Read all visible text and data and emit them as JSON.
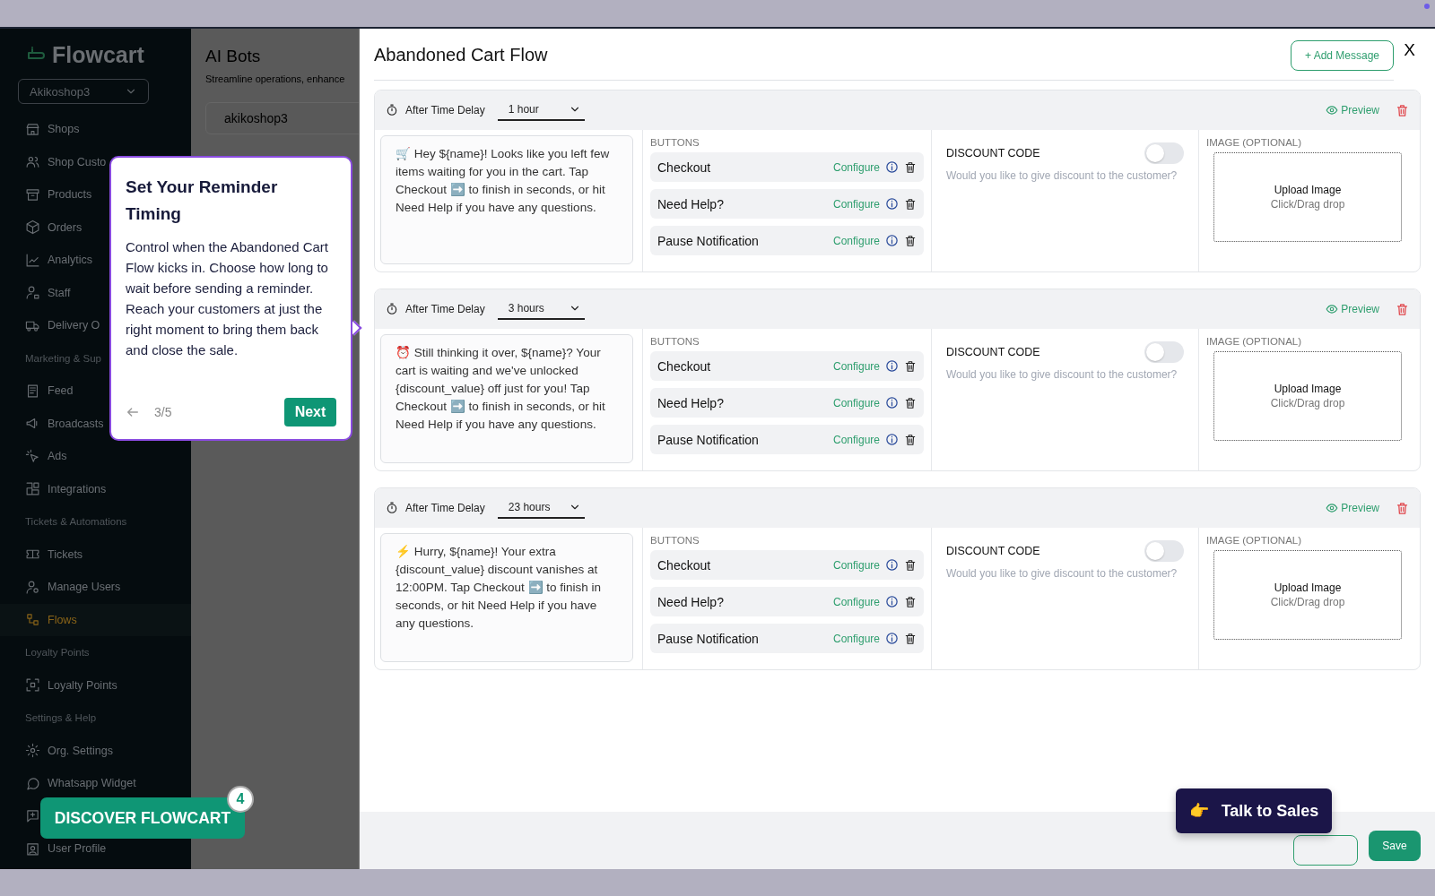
{
  "sidebar": {
    "logo": "Flowcart",
    "shop_select": "Akikoshop3",
    "items": [
      {
        "kind": "item",
        "label": "Shops",
        "selected": false
      },
      {
        "kind": "item",
        "label": "Shop Custo",
        "selected": false
      },
      {
        "kind": "item",
        "label": "Products",
        "selected": false
      },
      {
        "kind": "item",
        "label": "Orders",
        "selected": false
      },
      {
        "kind": "item",
        "label": "Analytics",
        "selected": false
      },
      {
        "kind": "item",
        "label": "Staff",
        "selected": false
      },
      {
        "kind": "item",
        "label": "Delivery O",
        "selected": false
      },
      {
        "kind": "section",
        "label": "Marketing & Sup"
      },
      {
        "kind": "item",
        "label": "Feed",
        "selected": false
      },
      {
        "kind": "item",
        "label": "Broadcasts",
        "selected": false
      },
      {
        "kind": "item",
        "label": "Ads",
        "selected": false
      },
      {
        "kind": "item",
        "label": "Integrations",
        "selected": false
      },
      {
        "kind": "section",
        "label": "Tickets & Automations"
      },
      {
        "kind": "item",
        "label": "Tickets",
        "selected": false
      },
      {
        "kind": "item",
        "label": "Manage Users",
        "selected": false
      },
      {
        "kind": "item",
        "label": "Flows",
        "selected": true
      },
      {
        "kind": "section",
        "label": "Loyalty Points"
      },
      {
        "kind": "item",
        "label": "Loyalty Points",
        "selected": false
      },
      {
        "kind": "section",
        "label": "Settings & Help"
      },
      {
        "kind": "item",
        "label": "Org. Settings",
        "selected": false
      },
      {
        "kind": "item",
        "label": "Whatsapp Widget",
        "selected": false
      },
      {
        "kind": "item",
        "selected": false
      },
      {
        "kind": "item",
        "label": "User Profile",
        "selected": false
      }
    ]
  },
  "background_page": {
    "title": "AI Bots",
    "subtitle": "Streamline operations, enhance",
    "search_value": "akikoshop3"
  },
  "modal": {
    "title": "Abandoned Cart Flow",
    "add_button": "+ Add Message",
    "close": "X",
    "messages": [
      {
        "delay_label": "After Time Delay",
        "delay": "1 hour",
        "preview": "Preview",
        "text": "🛒 Hey ${name}! Looks like you left few items waiting for you in the cart. Tap Checkout ➡️ to finish in seconds, or hit Need Help if you have any questions.",
        "buttons_label": "BUTTONS",
        "buttons": [
          {
            "label": "Checkout",
            "action": "Configure"
          },
          {
            "label": "Need Help?",
            "action": "Configure"
          },
          {
            "label": "Pause Notification",
            "action": "Configure"
          }
        ],
        "discount_label": "DISCOUNT CODE",
        "discount_on": false,
        "discount_hint": "Would you like to give discount to the customer?",
        "image_label": "IMAGE (OPTIONAL)",
        "upload_title": "Upload Image",
        "upload_hint": "Click/Drag drop"
      },
      {
        "delay_label": "After Time Delay",
        "delay": "3 hours",
        "preview": "Preview",
        "text": "⏰ Still thinking it over, ${name}? Your cart is waiting and we've unlocked {discount_value} off just for you! Tap Checkout ➡️ to finish in seconds, or hit Need Help if you have any questions.",
        "buttons_label": "BUTTONS",
        "buttons": [
          {
            "label": "Checkout",
            "action": "Configure"
          },
          {
            "label": "Need Help?",
            "action": "Configure"
          },
          {
            "label": "Pause Notification",
            "action": "Configure"
          }
        ],
        "discount_label": "DISCOUNT CODE",
        "discount_on": false,
        "discount_hint": "Would you like to give discount to the customer?",
        "image_label": "IMAGE (OPTIONAL)",
        "upload_title": "Upload Image",
        "upload_hint": "Click/Drag drop"
      },
      {
        "delay_label": "After Time Delay",
        "delay": "23 hours",
        "preview": "Preview",
        "text": "⚡ Hurry, ${name}! Your extra {discount_value} discount vanishes at 12:00PM. Tap Checkout ➡️ to finish in seconds, or hit Need Help if you have any questions.",
        "buttons_label": "BUTTONS",
        "buttons": [
          {
            "label": "Checkout",
            "action": "Configure"
          },
          {
            "label": "Need Help?",
            "action": "Configure"
          },
          {
            "label": "Pause Notification",
            "action": "Configure"
          }
        ],
        "discount_label": "DISCOUNT CODE",
        "discount_on": false,
        "discount_hint": "Would you like to give discount to the customer?",
        "image_label": "IMAGE (OPTIONAL)",
        "upload_title": "Upload Image",
        "upload_hint": "Click/Drag drop"
      }
    ],
    "save": "Save"
  },
  "tour": {
    "title": "Set Your Reminder Timing",
    "body": "Control when the Abandoned Cart Flow kicks in. Choose how long to wait before sending a reminder. Reach your customers at just the right moment to bring them back and close the sale.",
    "step": "3/5",
    "next": "Next"
  },
  "discover": {
    "label": "DISCOVER FLOWCART",
    "badge": "4"
  },
  "talk_to_sales": {
    "emoji": "👉",
    "label": "Talk to Sales"
  }
}
